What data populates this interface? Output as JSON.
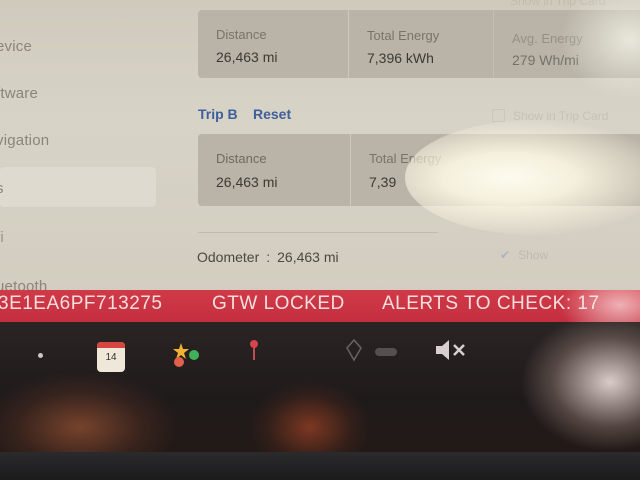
{
  "sidebar": {
    "items": [
      "evice",
      "ftware",
      "vigation",
      "s",
      "fi",
      "uetooth"
    ]
  },
  "trip_a": {
    "distance_label": "Distance",
    "distance_value": "26,463 mi",
    "energy_label": "Total Energy",
    "energy_value": "7,396 kWh",
    "avg_label": "Avg. Energy",
    "avg_value": "279 Wh/mi",
    "checkbox_label": "Show in Trip Card"
  },
  "trip_b": {
    "title": "Trip B",
    "reset_label": "Reset",
    "distance_label": "Distance",
    "distance_value": "26,463 mi",
    "energy_label": "Total Energy",
    "energy_value": "7,39",
    "checkbox_label": "Show in Trip Card"
  },
  "odometer": {
    "label": "Odometer",
    "separator": ":",
    "value": "26,463 mi",
    "checkbox_label": "Show"
  },
  "alert_bar": {
    "vin": "3E1EA6PF713275",
    "status": "GTW LOCKED",
    "alerts": "ALERTS TO CHECK: 17"
  },
  "taskbar": {
    "calendar_day": "14"
  },
  "colors": {
    "alert_red": "#c9323f",
    "link_blue": "#3f5f9c",
    "panel_bg": "#d4cfc3"
  }
}
